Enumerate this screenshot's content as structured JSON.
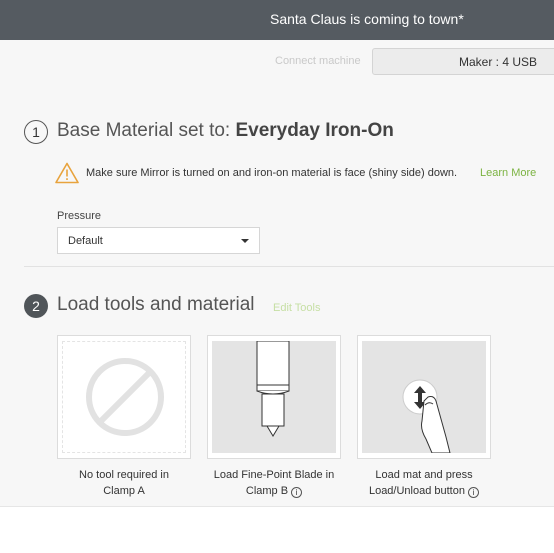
{
  "titlebar": {
    "title": "Santa Claus is coming to town*"
  },
  "machine": {
    "connect_label": "Connect machine",
    "device_label": "Maker : 4 USB"
  },
  "step1": {
    "number": "1",
    "heading_prefix": "Base Material set to: ",
    "heading_material": "Everyday Iron-On",
    "warning_icon": "warning-triangle-icon",
    "warning_text": "Make sure Mirror is turned on and iron-on material is face (shiny side) down.",
    "learn_more": "Learn More",
    "pressure_label": "Pressure",
    "pressure_value": "Default"
  },
  "step2": {
    "number": "2",
    "heading": "Load tools and material",
    "edit_tools": "Edit Tools",
    "cards": [
      {
        "icon": "no-tool-icon",
        "caption_line1": "No tool required in",
        "caption_line2": "Clamp A"
      },
      {
        "icon": "fine-point-blade-icon",
        "caption_line1": "Load Fine-Point Blade in",
        "caption_line2": "Clamp B"
      },
      {
        "icon": "load-unload-button-icon",
        "caption_line1": "Load mat and press",
        "caption_line2": "Load/Unload button"
      }
    ]
  },
  "colors": {
    "titlebar": "#555b61",
    "accent_green": "#7cb342",
    "warning": "#e8a33d"
  }
}
